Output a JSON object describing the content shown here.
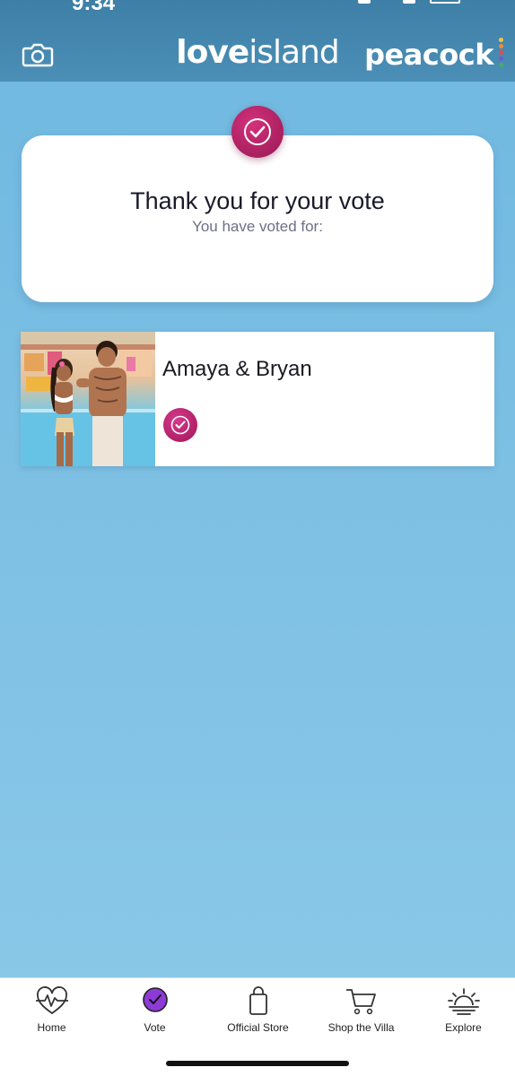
{
  "status_bar": {
    "time": "9:34"
  },
  "header": {
    "brand_love": "love",
    "brand_island": "island",
    "partner_logo": "peacock",
    "camera_icon": "camera-icon"
  },
  "confirmation": {
    "title": "Thank you for your vote",
    "subtitle": "You have voted for:",
    "badge_icon": "check-circle-icon"
  },
  "voted_couple": {
    "name": "Amaya & Bryan",
    "photo": "couple-photo",
    "selected_icon": "check-circle-icon"
  },
  "bottom_nav": {
    "items": [
      {
        "label": "Home",
        "icon": "heartbeat-icon",
        "active": false
      },
      {
        "label": "Vote",
        "icon": "vote-check-icon",
        "active": true
      },
      {
        "label": "Official Store",
        "icon": "shopping-bag-icon",
        "active": false
      },
      {
        "label": "Shop the Villa",
        "icon": "cart-icon",
        "active": false
      },
      {
        "label": "Explore",
        "icon": "sunset-icon",
        "active": false
      }
    ]
  },
  "colors": {
    "accent": "#b0226a",
    "vote_active": "#8e3ad8",
    "header": "#3d7fa6",
    "background": "#7dc0e4"
  }
}
